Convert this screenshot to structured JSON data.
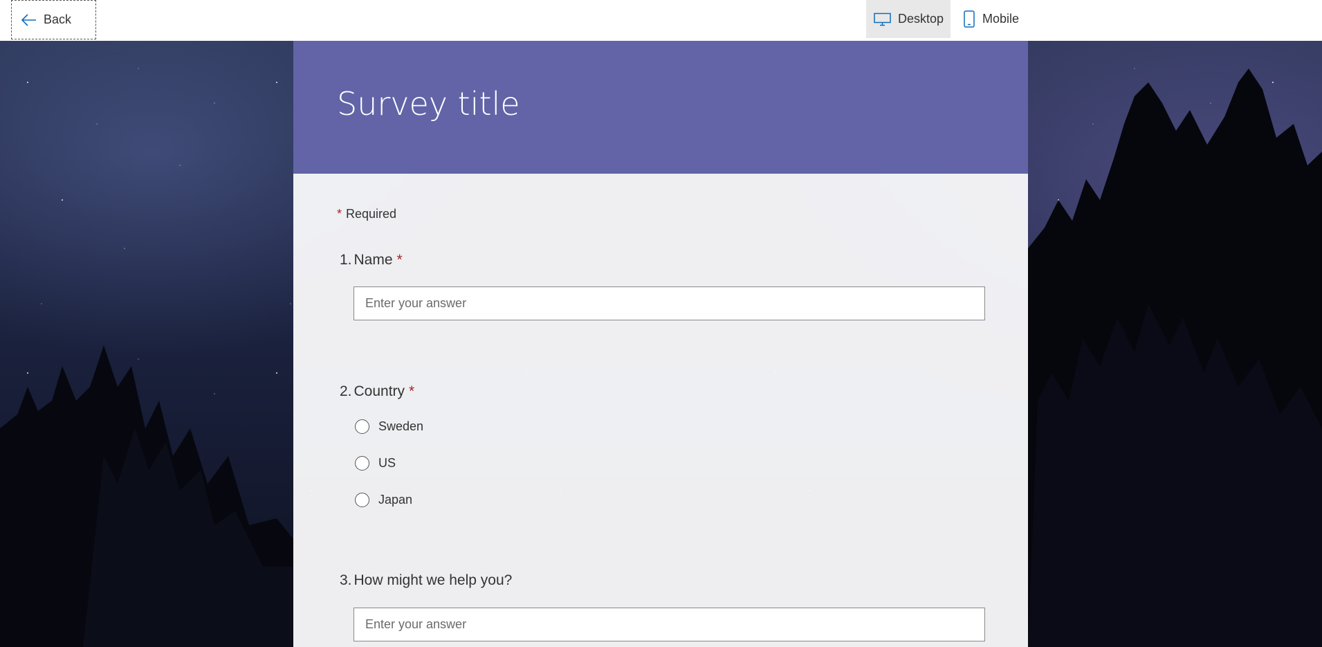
{
  "topbar": {
    "back_label": "Back",
    "desktop_label": "Desktop",
    "mobile_label": "Mobile",
    "selected_view": "Desktop"
  },
  "survey": {
    "title": "Survey title",
    "header_color": "#6264a7",
    "required_note": "Required",
    "required_marker": "*",
    "questions": [
      {
        "number": "1.",
        "title": "Name",
        "required": "*",
        "type": "text",
        "placeholder": "Enter your answer"
      },
      {
        "number": "2.",
        "title": "Country",
        "required": "*",
        "type": "choice",
        "options": [
          "Sweden",
          "US",
          "Japan"
        ]
      },
      {
        "number": "3.",
        "title": "How might we help you?",
        "type": "text",
        "placeholder": "Enter your answer"
      }
    ]
  }
}
